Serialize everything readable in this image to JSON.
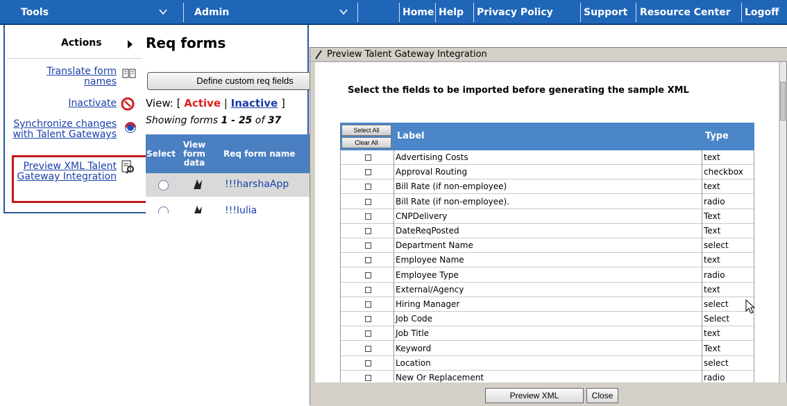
{
  "topbar": {
    "tools": "Tools",
    "admin": "Admin",
    "links": [
      "Home",
      "Help",
      "Privacy Policy",
      "Support",
      "Resource Center",
      "Logoff"
    ]
  },
  "page": {
    "actions_title": "Actions",
    "title": "Req forms",
    "actions": {
      "translate": "Translate form names",
      "inactivate": "Inactivate",
      "synchronize": "Synchronize changes with Talent Gateways",
      "preview": "Preview XML Talent Gateway Integration"
    },
    "define_button": "Define custom req fields",
    "view": {
      "prefix": "View: [",
      "active": "Active",
      "sep": "|",
      "inactive": "Inactive",
      "suffix": "]"
    },
    "showing": {
      "prefix": "Showing forms ",
      "range": "1 - 25",
      "of": " of ",
      "total": "37"
    },
    "table": {
      "headers": [
        "Select",
        "View form data",
        "Req form name"
      ],
      "rows": [
        "!!!harshaApp",
        "!!!Julia"
      ]
    }
  },
  "dialog": {
    "title": "Preview Talent Gateway Integration",
    "heading": "Select the fields to be imported before generating the sample XML",
    "select_all": "Select All",
    "clear_all": "Clear All",
    "col_label": "Label",
    "col_type": "Type",
    "fields": [
      {
        "label": "Advertising Costs",
        "type": "text"
      },
      {
        "label": "Approval Routing",
        "type": "checkbox"
      },
      {
        "label": "Bill Rate (if non-employee)",
        "type": "text"
      },
      {
        "label": "Bill Rate (if non-employee).",
        "type": "radio"
      },
      {
        "label": "CNPDelivery",
        "type": "Text"
      },
      {
        "label": "DateReqPosted",
        "type": "Text"
      },
      {
        "label": "Department Name",
        "type": "select"
      },
      {
        "label": "Employee Name",
        "type": "text"
      },
      {
        "label": "Employee Type",
        "type": "radio"
      },
      {
        "label": "External/Agency",
        "type": "text"
      },
      {
        "label": "Hiring Manager",
        "type": "select"
      },
      {
        "label": "Job Code",
        "type": "Select"
      },
      {
        "label": "Job Title",
        "type": "text"
      },
      {
        "label": "Keyword",
        "type": "Text"
      },
      {
        "label": "Location",
        "type": "select"
      },
      {
        "label": "New Or Replacement",
        "type": "radio"
      }
    ],
    "preview_button": "Preview XML",
    "close_button": "Close"
  },
  "colors": {
    "nav_blue": "#1f66b8",
    "table_header_blue": "#4a86c8",
    "highlight_red": "#c4191c",
    "link_blue": "#1a3fa8",
    "active_red": "#e01f1f"
  }
}
